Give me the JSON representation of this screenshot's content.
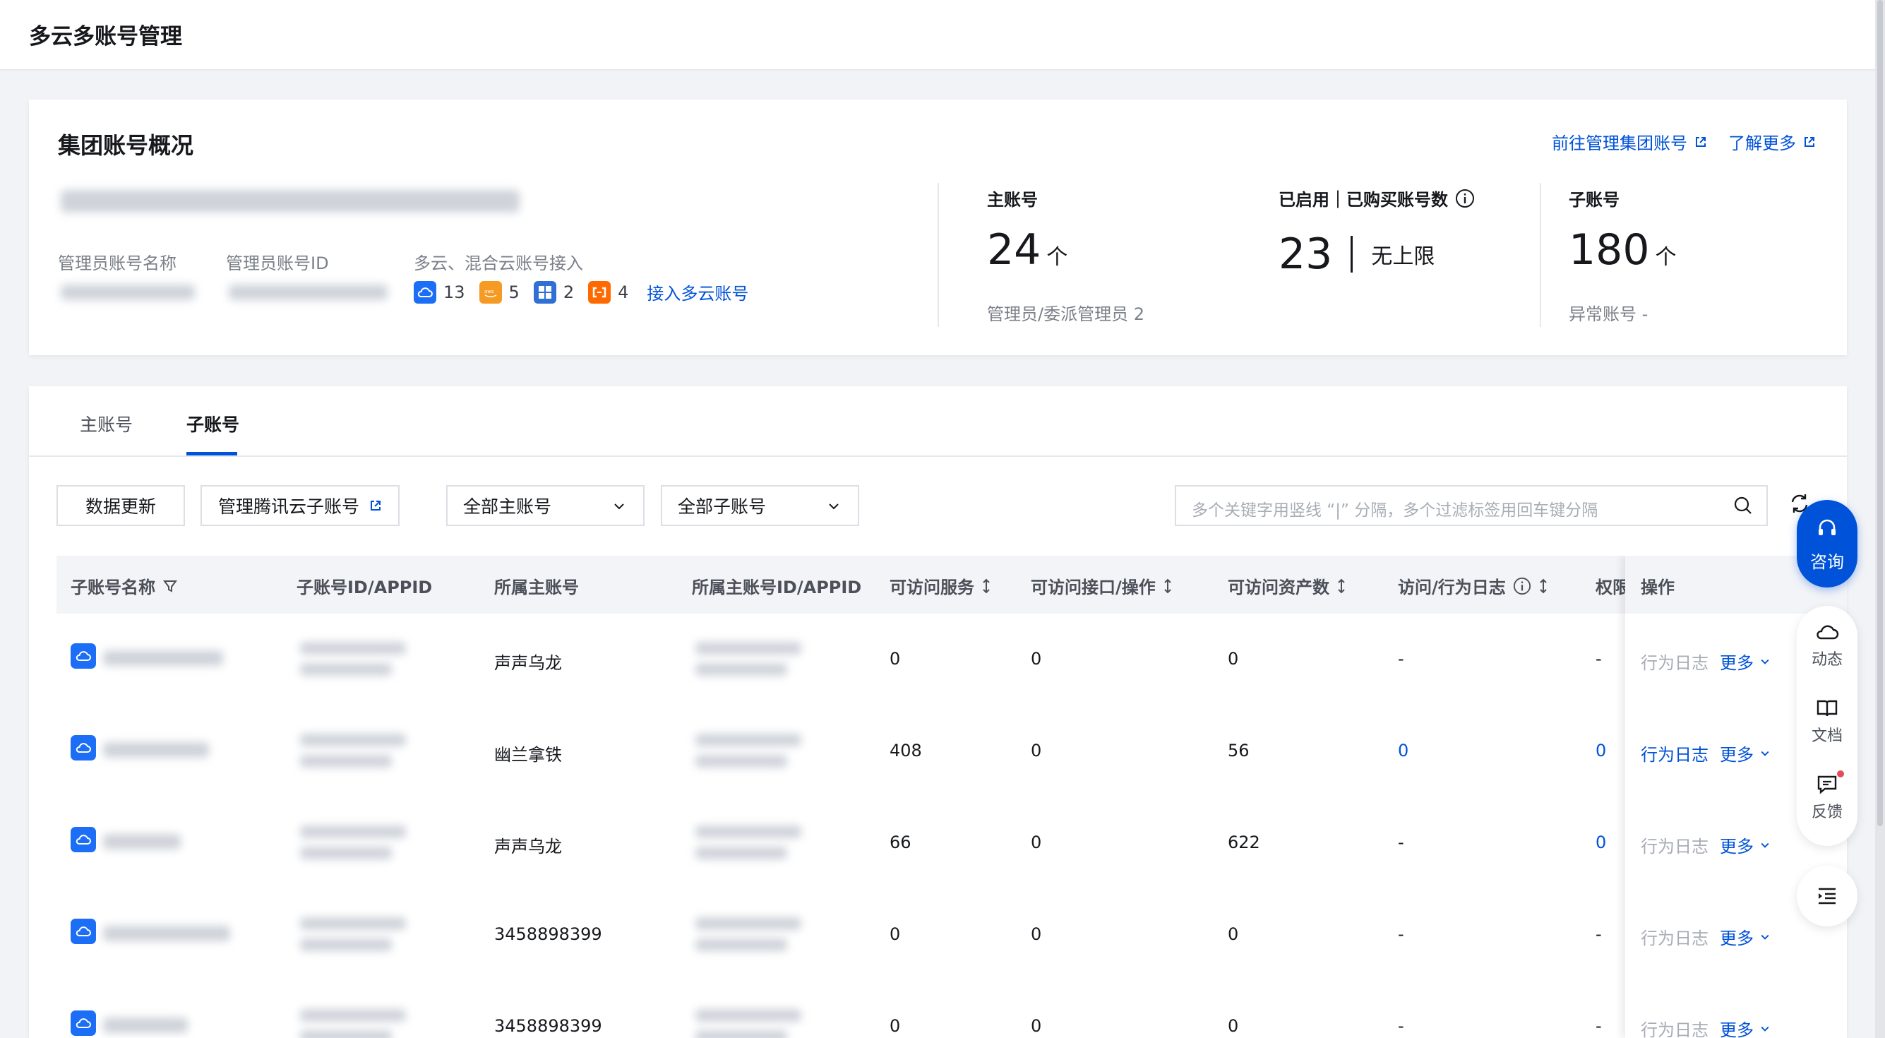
{
  "page": {
    "title": "多云多账号管理"
  },
  "overview": {
    "title": "集团账号概况",
    "links": [
      {
        "label": "前往管理集团账号"
      },
      {
        "label": "了解更多"
      }
    ],
    "admin_name_label": "管理员账号名称",
    "admin_id_label": "管理员账号ID",
    "multicloud_label": "多云、混合云账号接入",
    "clouds": [
      {
        "icon": "tencent-cloud-icon",
        "count": "13",
        "color": "#1b6ef5"
      },
      {
        "icon": "aws-icon",
        "count": "5",
        "color": "#f59a23"
      },
      {
        "icon": "azure-icon",
        "count": "2",
        "color": "#2f6fd6"
      },
      {
        "icon": "aliyun-icon",
        "count": "4",
        "color": "#ff6a00"
      }
    ],
    "connect_label": "接入多云账号",
    "stats": {
      "main": {
        "label": "主账号",
        "value": "24",
        "unit": "个",
        "sub": "管理员/委派管理员 2"
      },
      "enabled": {
        "label": "已启用｜已购买账号数",
        "value": "23",
        "limit": "无上限"
      },
      "sub": {
        "label": "子账号",
        "value": "180",
        "unit": "个",
        "sub": "异常账号 -"
      }
    }
  },
  "tabs": [
    {
      "label": "主账号"
    },
    {
      "label": "子账号"
    }
  ],
  "toolbar": {
    "refresh_data": "数据更新",
    "manage_sub": "管理腾讯云子账号",
    "main_filter": "全部主账号",
    "sub_filter": "全部子账号",
    "search_placeholder": "多个关键字用竖线 “|” 分隔，多个过滤标签用回车键分隔"
  },
  "table": {
    "columns": [
      "子账号名称",
      "子账号ID/APPID",
      "所属主账号",
      "所属主账号ID/APPID",
      "可访问服务",
      "可访问接口/操作",
      "可访问资产数",
      "访问/行为日志",
      "权限",
      "操作"
    ],
    "rows": [
      {
        "main": "声声乌龙",
        "services": "0",
        "apis": "0",
        "assets": "0",
        "logs": "-",
        "perm": "-",
        "log_active": false
      },
      {
        "main": "幽兰拿铁",
        "services": "408",
        "apis": "0",
        "assets": "56",
        "logs": "0",
        "perm": "0",
        "log_active": true
      },
      {
        "main": "声声乌龙",
        "services": "66",
        "apis": "0",
        "assets": "622",
        "logs": "-",
        "perm": "0",
        "log_active": false
      },
      {
        "main": "3458898399",
        "services": "0",
        "apis": "0",
        "assets": "0",
        "logs": "-",
        "perm": "-",
        "log_active": false
      },
      {
        "main": "3458898399",
        "services": "0",
        "apis": "0",
        "assets": "0",
        "logs": "-",
        "perm": "-",
        "log_active": false
      }
    ],
    "op_log": "行为日志",
    "op_more": "更多"
  },
  "assistant": {
    "consult": "咨询",
    "items": [
      {
        "label": "动态"
      },
      {
        "label": "文档"
      },
      {
        "label": "反馈"
      }
    ]
  }
}
